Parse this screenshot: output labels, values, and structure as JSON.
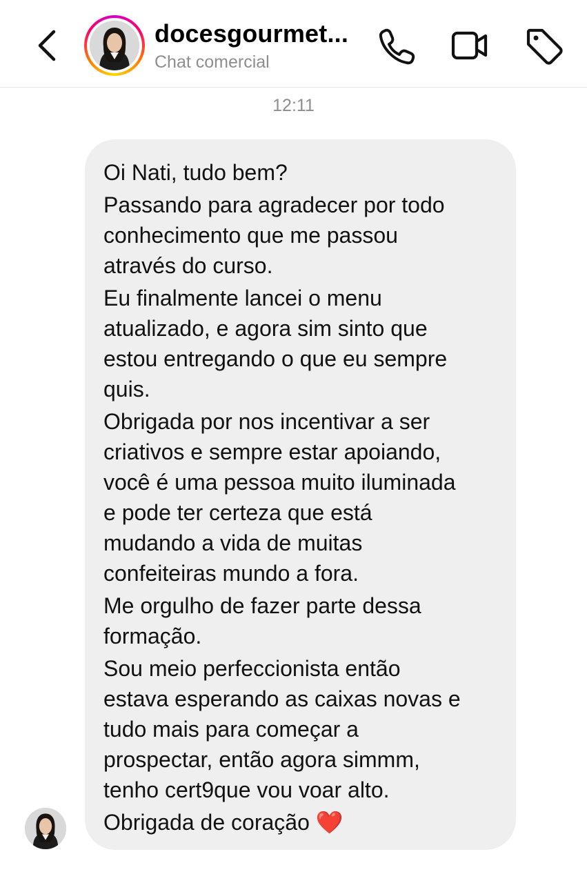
{
  "header": {
    "title": "docesgourmet...",
    "subtitle": "Chat comercial",
    "back_icon": "chevron-left-icon",
    "actions": [
      {
        "name": "phone-icon"
      },
      {
        "name": "video-camera-icon"
      },
      {
        "name": "tag-icon"
      }
    ]
  },
  "thread": {
    "timestamp": "12:11",
    "message": {
      "paragraphs": [
        {
          "lines": [
            "Oi Nati, tudo bem?"
          ]
        },
        {
          "lines": [
            "Passando para agradecer por todo",
            "conhecimento que me passou",
            "através do curso."
          ]
        },
        {
          "lines": [
            "Eu finalmente lancei o menu",
            "atualizado, e agora sim sinto que",
            "estou entregando o que eu sempre",
            "quis."
          ]
        },
        {
          "lines": [
            "Obrigada por nos incentivar a ser",
            "criativos e sempre estar apoiando,",
            "você é uma pessoa muito iluminada",
            "e pode ter certeza que está",
            "mudando a vida de muitas",
            "confeiteiras mundo a fora."
          ]
        },
        {
          "lines": [
            "Me orgulho de fazer parte dessa",
            "formação."
          ]
        },
        {
          "lines": [
            "Sou meio perfeccionista então",
            "estava esperando as caixas novas e",
            "tudo mais para começar a",
            "prospectar, então agora simmm,",
            "tenho cert9que vou voar alto."
          ]
        },
        {
          "lines": [
            "Obrigada de coração"
          ],
          "emoji": "❤️"
        }
      ]
    }
  },
  "colors": {
    "bubble": "#efefef",
    "muted_text": "#8e8e8e",
    "heart": "#e0202a"
  }
}
